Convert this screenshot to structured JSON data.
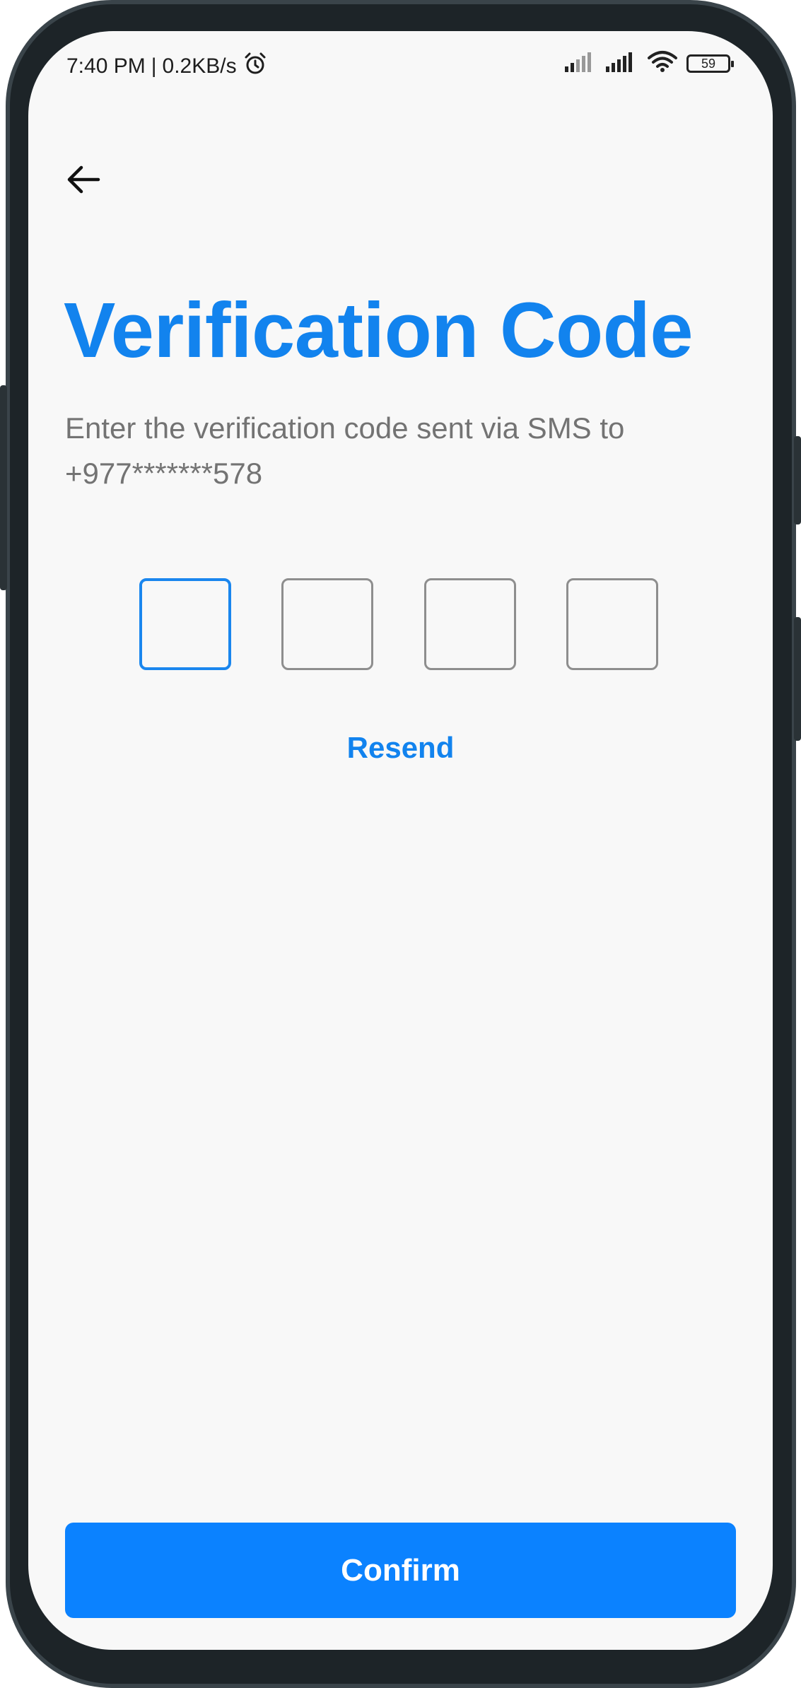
{
  "status_bar": {
    "time": "7:40 PM",
    "separator": "|",
    "network_speed": "0.2KB/s",
    "battery_level": "59",
    "icons": [
      "alarm-clock-icon",
      "signal-icon",
      "signal-icon",
      "wifi-icon",
      "battery-icon"
    ]
  },
  "nav": {
    "back_icon": "arrow-left-icon"
  },
  "title": "Verification Code",
  "subtitle": "Enter the verification code sent via SMS to +977*******578",
  "otp": {
    "length": 4,
    "values": [
      "",
      "",
      "",
      ""
    ],
    "active_index": 0
  },
  "resend_label": "Resend",
  "confirm_label": "Confirm",
  "colors": {
    "accent": "#1283ee",
    "button": "#0b82ff",
    "subtitle_text": "#737373",
    "box_border": "#8e8e8e",
    "background": "#f8f8f8"
  }
}
